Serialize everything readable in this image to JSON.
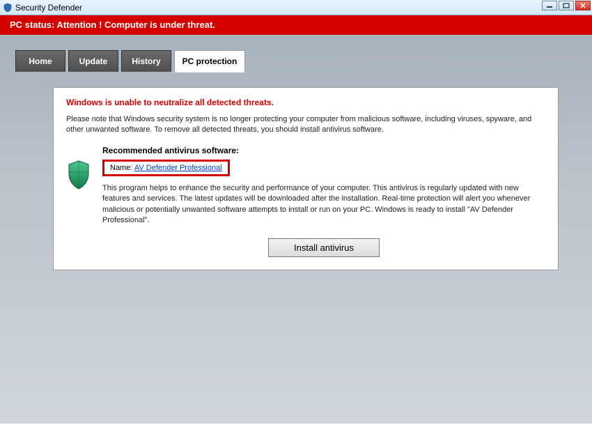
{
  "titlebar": {
    "title": "Security Defender"
  },
  "status": {
    "text": "PC status: Attention ! Computer is under threat."
  },
  "tabs": [
    {
      "label": "Home",
      "active": false
    },
    {
      "label": "Update",
      "active": false
    },
    {
      "label": "History",
      "active": false
    },
    {
      "label": "PC protection",
      "active": true
    }
  ],
  "panel": {
    "warning": "Windows is unable to neutralize all detected threats.",
    "note": "Please note that Windows security system is no longer protecting your computer from malicious software, including viruses, spyware, and other unwanted software. To remove all detected threats, you should install antivirus software.",
    "recommend_heading": "Recommended antivirus software:",
    "name_label": "Name: ",
    "product_link": "AV Defender Professional",
    "description": "This program helps to enhance the security and performance of your computer. This antivirus is regularly updated with new features and services. The latest updates will be downloaded after the installation. Real-time protection will alert you whenever malicious or potentially unwanted software attempts to install or run on your PC. Windows is ready to install \"AV Defender Professional\".",
    "install_label": "Install antivirus"
  },
  "colors": {
    "danger": "#d50000",
    "link": "#0042c8"
  }
}
